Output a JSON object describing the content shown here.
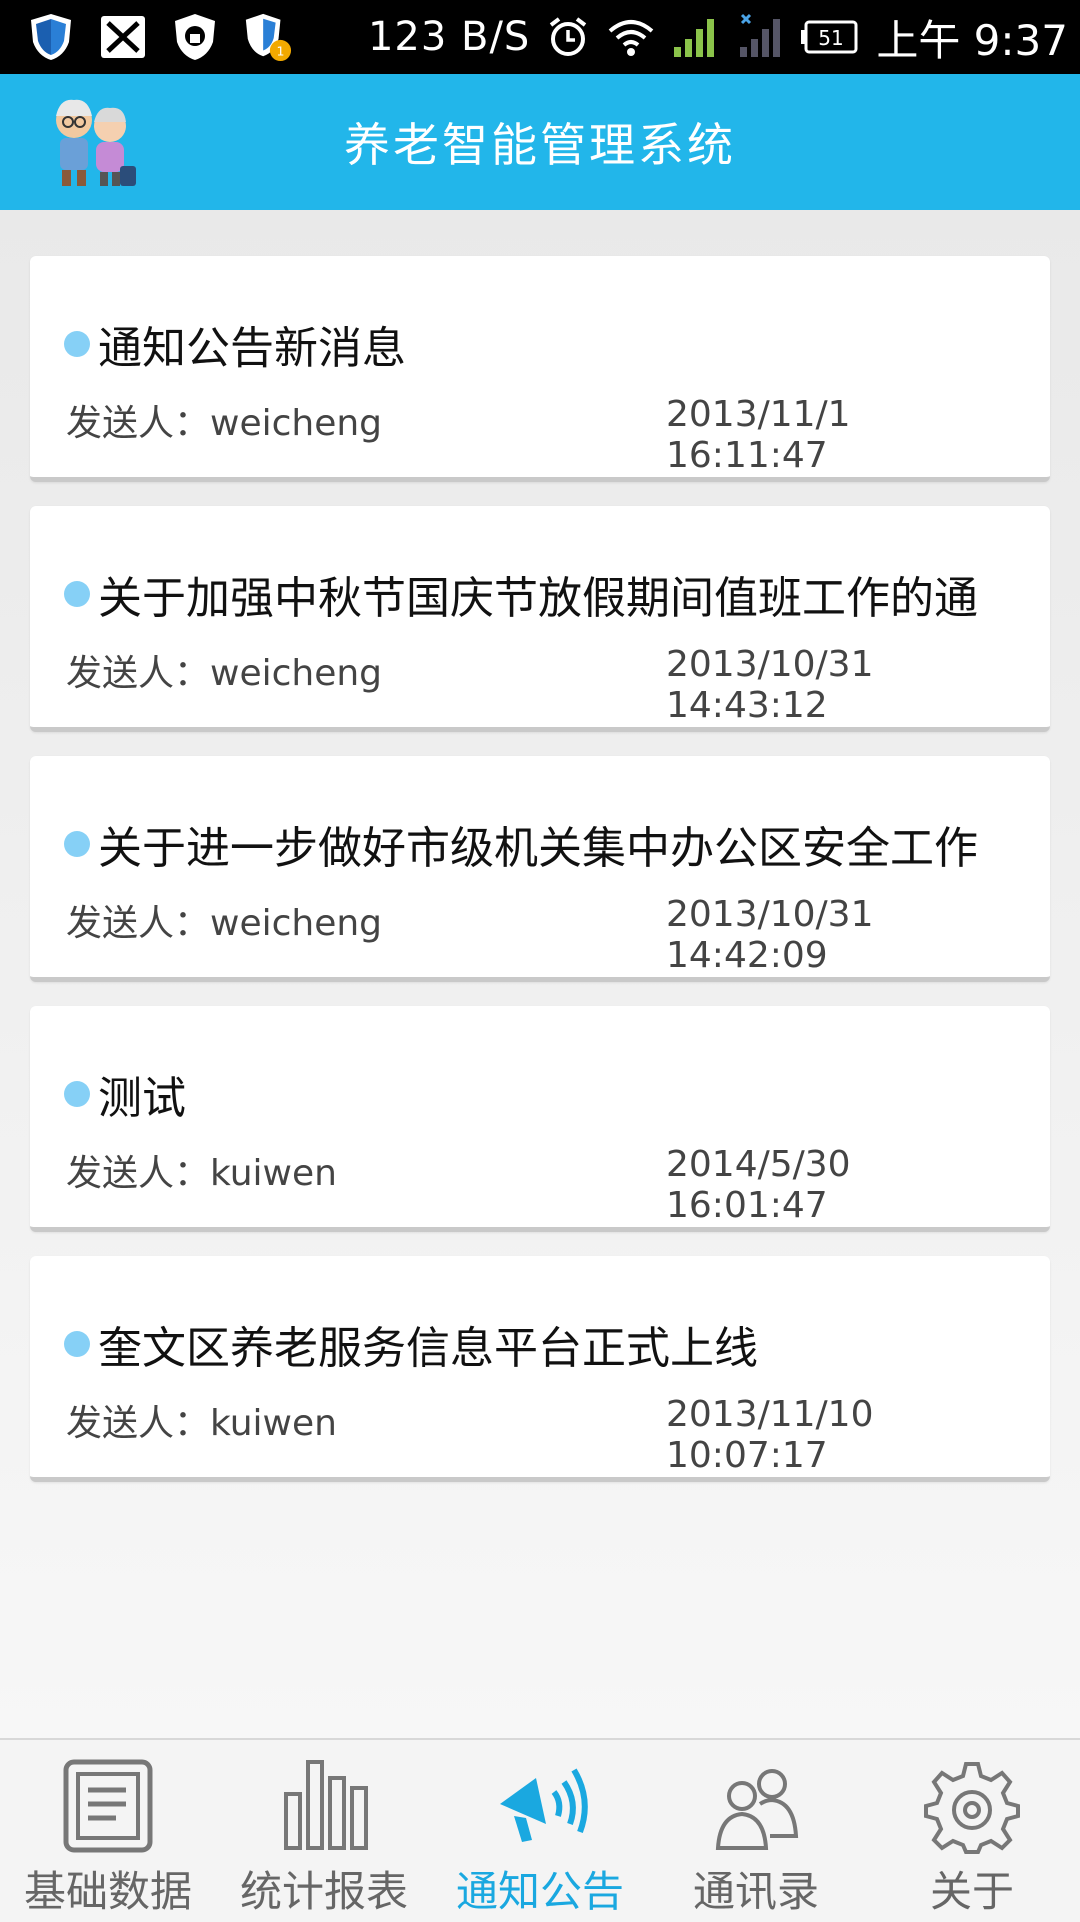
{
  "status_bar": {
    "speed": "123 B/S",
    "battery": "51",
    "time": "上午 9:37",
    "icons": [
      "shield-icon",
      "wallet-icon",
      "lock-shield-icon",
      "shield-badge-icon",
      "alarm-icon",
      "wifi-icon",
      "signal-icon",
      "signal-off-icon",
      "battery-icon"
    ]
  },
  "header": {
    "title": "养老智能管理系统",
    "logo": "elderly-couple-logo"
  },
  "notices": [
    {
      "title": "通知公告新消息",
      "sender": "发送人：weicheng",
      "time": "2013/11/1 16:11:47"
    },
    {
      "title": "关于加强中秋节国庆节放假期间值班工作的通",
      "sender": "发送人：weicheng",
      "time": "2013/10/31 14:43:12"
    },
    {
      "title": "关于进一步做好市级机关集中办公区安全工作",
      "sender": "发送人：weicheng",
      "time": "2013/10/31 14:42:09"
    },
    {
      "title": "测试",
      "sender": "发送人：kuiwen",
      "time": "2014/5/30 16:01:47"
    },
    {
      "title": "奎文区养老服务信息平台正式上线",
      "sender": "发送人：kuiwen",
      "time": "2013/11/10 10:07:17"
    }
  ],
  "nav": {
    "items": [
      {
        "label": "基础数据",
        "icon": "document-icon"
      },
      {
        "label": "统计报表",
        "icon": "bar-chart-icon"
      },
      {
        "label": "通知公告",
        "icon": "megaphone-icon",
        "active": true
      },
      {
        "label": "通讯录",
        "icon": "contacts-icon"
      },
      {
        "label": "关于",
        "icon": "gear-icon"
      }
    ],
    "active_color": "#1aa8e0"
  },
  "colors": {
    "header": "#22b6ea",
    "dot": "#86d0f6"
  }
}
